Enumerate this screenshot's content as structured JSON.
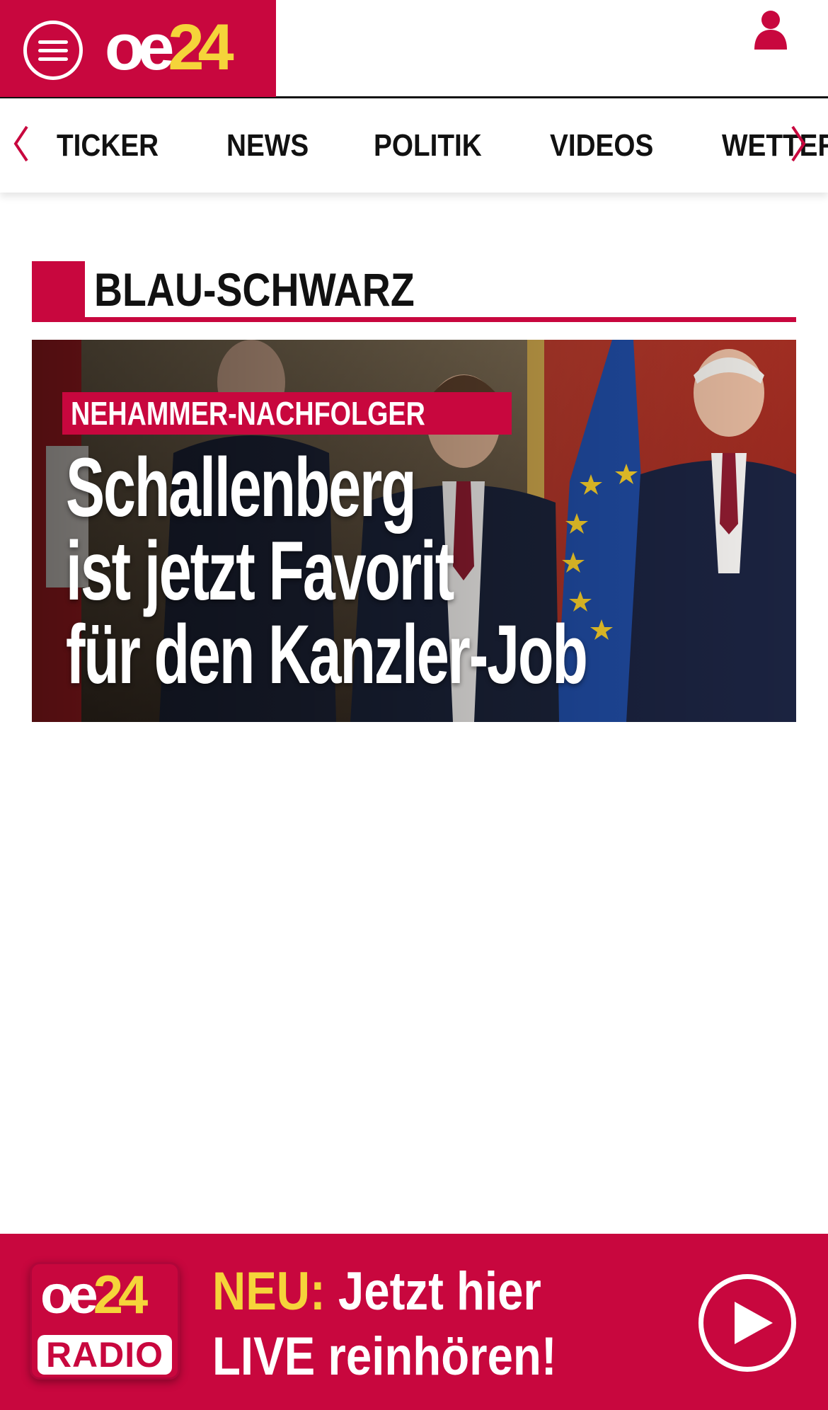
{
  "header": {
    "brand_oe": "oe",
    "brand_num": "24",
    "menu_icon": "hamburger-menu-icon",
    "user_icon": "user-icon",
    "brand_color": "#c8073e",
    "accent_color": "#f5d43a"
  },
  "nav": {
    "prev_icon": "chevron-left-icon",
    "next_icon": "chevron-right-icon",
    "items": [
      {
        "label": "TICKER"
      },
      {
        "label": "NEWS"
      },
      {
        "label": "POLITIK"
      },
      {
        "label": "VIDEOS"
      },
      {
        "label": "WETTER"
      }
    ]
  },
  "section": {
    "title": "BLAU-SCHWARZ"
  },
  "hero": {
    "kicker": "NEHAMMER-NACHFOLGER",
    "headline_lines": [
      "Schallenberg",
      "ist jetzt Favorit",
      "für den Kanzler-Job"
    ]
  },
  "radio": {
    "logo_oe": "oe",
    "logo_num": "24",
    "logo_radio": "RADIO",
    "line1_highlight": "NEU:",
    "line1_rest": " Jetzt hier",
    "line2": "LIVE reinhören!",
    "play_icon": "play-icon"
  }
}
